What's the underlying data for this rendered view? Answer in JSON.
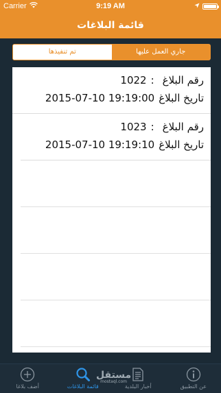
{
  "status_bar": {
    "carrier": "Carrier",
    "time": "9:19 AM"
  },
  "nav": {
    "title": "قائمة البلاغات"
  },
  "segments": [
    {
      "label": "تم تنفيذها",
      "active": false
    },
    {
      "label": "جاري العمل عليها",
      "active": true
    }
  ],
  "reports": [
    {
      "number_label": "رقم البلاغ",
      "separator": ":",
      "number": "1022",
      "date_label": "تاريخ البلاغ",
      "date": "2015-07-10 19:19:00"
    },
    {
      "number_label": "رقم البلاغ",
      "separator": ":",
      "number": "1023",
      "date_label": "تاريخ البلاغ",
      "date": "2015-07-10 19:19:10"
    }
  ],
  "tabs": [
    {
      "label": "أضف بلاغا",
      "icon": "plus-circle-icon",
      "active": false
    },
    {
      "label": "قائمة البلاغات",
      "icon": "search-icon",
      "active": true
    },
    {
      "label": "أخبار البلدية",
      "icon": "document-icon",
      "active": false
    },
    {
      "label": "عن التطبيق",
      "icon": "info-icon",
      "active": false
    }
  ],
  "watermark": {
    "main": "مستقل",
    "sub": "mostaql.com"
  },
  "colors": {
    "accent": "#e9902c",
    "tab_active": "#2f95e8",
    "tab_inactive": "#8a96a0",
    "background": "#1b2a35"
  }
}
